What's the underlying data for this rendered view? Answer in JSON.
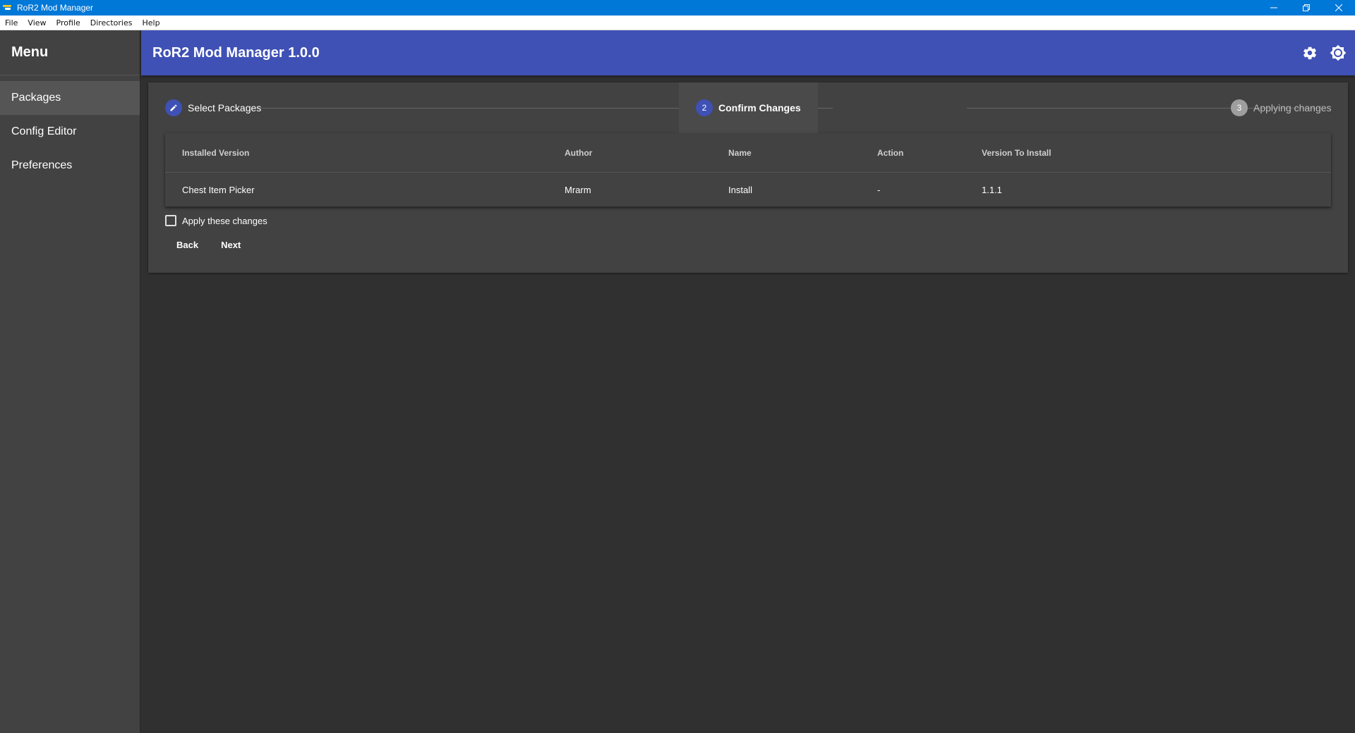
{
  "window": {
    "title": "RoR2 Mod Manager"
  },
  "menubar": [
    "File",
    "View",
    "Profile",
    "Directories",
    "Help"
  ],
  "sidebar": {
    "heading": "Menu",
    "items": [
      {
        "label": "Packages",
        "active": true
      },
      {
        "label": "Config Editor",
        "active": false
      },
      {
        "label": "Preferences",
        "active": false
      }
    ]
  },
  "appbar": {
    "title": "RoR2 Mod Manager 1.0.0",
    "icons": [
      "settings-gear-icon",
      "brightness-icon"
    ]
  },
  "stepper": {
    "steps": [
      {
        "number": "1",
        "label": "Select Packages",
        "state": "completed",
        "icon": "pencil-icon"
      },
      {
        "number": "2",
        "label": "Confirm Changes",
        "state": "active"
      },
      {
        "number": "3",
        "label": "Applying changes",
        "state": "disabled"
      }
    ]
  },
  "table": {
    "headers": [
      "Installed Version",
      "Author",
      "Name",
      "Action",
      "Version To Install"
    ],
    "rows": [
      [
        "Chest Item Picker",
        "Mrarm",
        "Install",
        "-",
        "1.1.1"
      ]
    ]
  },
  "confirm": {
    "label": "Apply these changes",
    "checked": false
  },
  "buttons": {
    "back": "Back",
    "next": "Next"
  },
  "colors": {
    "titlebar": "#0078d7",
    "primary": "#3f51b5",
    "panel": "#424242",
    "background": "#303030"
  }
}
